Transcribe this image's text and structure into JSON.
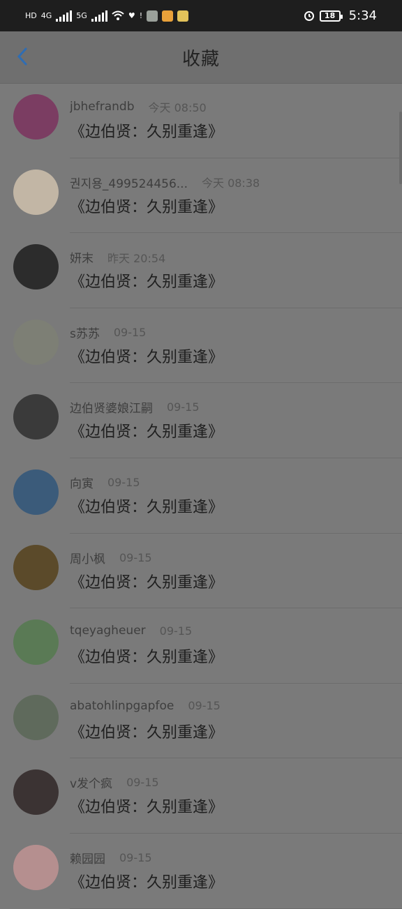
{
  "status_bar": {
    "signal_1": "4G",
    "signal_2": "5G",
    "battery": "18",
    "time": "5:34"
  },
  "app_bar": {
    "title": "收藏"
  },
  "list": [
    {
      "name": "jbhefrandb",
      "time": "今天 08:50",
      "title": "《边伯贤：久别重逢》",
      "avatar_color": "#7b3d62"
    },
    {
      "name": "권지용_499524456...",
      "time": "今天 08:38",
      "title": "《边伯贤：久别重逢》",
      "avatar_color": "#c2b6a5"
    },
    {
      "name": "妍末",
      "time": "昨天 20:54",
      "title": "《边伯贤：久别重逢》",
      "avatar_color": "#2c2c2c"
    },
    {
      "name": "s苏苏",
      "time": "09-15",
      "title": "《边伯贤：久别重逢》",
      "avatar_color": "#7d7f75"
    },
    {
      "name": "边伯贤婆娘江嗣",
      "time": "09-15",
      "title": "《边伯贤：久别重逢》",
      "avatar_color": "#3a3a3a"
    },
    {
      "name": "向寅",
      "time": "09-15",
      "title": "《边伯贤：久别重逢》",
      "avatar_color": "#3b5b7a"
    },
    {
      "name": "周小枫",
      "time": "09-15",
      "title": "《边伯贤：久别重逢》",
      "avatar_color": "#5b4a2a"
    },
    {
      "name": "tqeyagheuer",
      "time": "09-15",
      "title": "《边伯贤：久别重逢》",
      "avatar_color": "#5a7a55"
    },
    {
      "name": "abatohlinpgapfoe",
      "time": "09-15",
      "title": "《边伯贤：久别重逢》",
      "avatar_color": "#5f6a5c"
    },
    {
      "name": "v发个疯",
      "time": "09-15",
      "title": "《边伯贤：久别重逢》",
      "avatar_color": "#3b3333"
    },
    {
      "name": "赖园园",
      "time": "09-15",
      "title": "《边伯贤：久别重逢》",
      "avatar_color": "#b58f8f"
    }
  ]
}
